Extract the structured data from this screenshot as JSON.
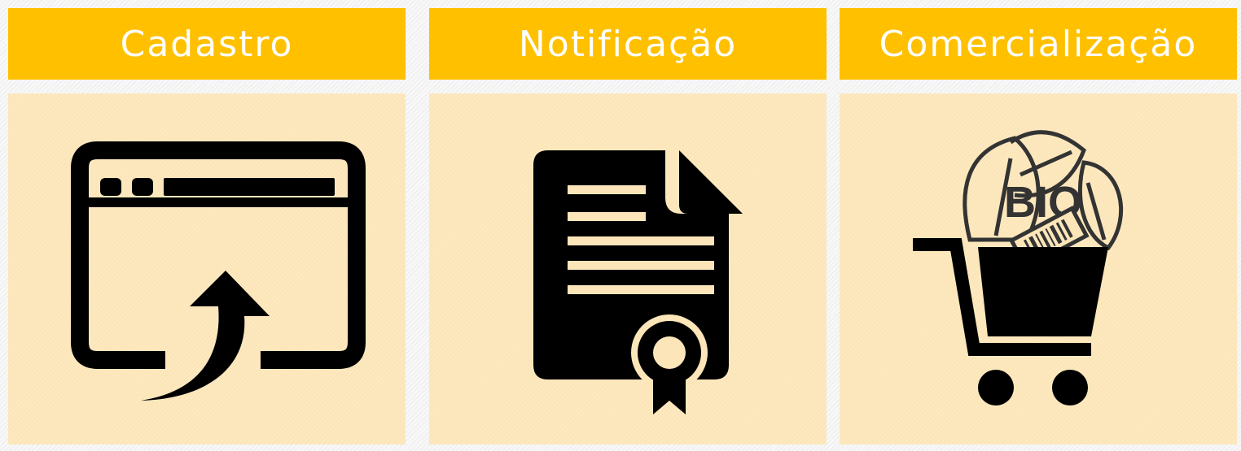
{
  "columns": [
    {
      "label": "Cadastro",
      "icon": "browser-upload-icon"
    },
    {
      "label": "Notificação",
      "icon": "certificate-document-icon"
    },
    {
      "label": "Comercialização",
      "icon": "bio-shopping-cart-icon"
    }
  ],
  "bio_badge": "BIO",
  "colors": {
    "header_bg": "#ffc000",
    "header_text": "#ffffff",
    "panel_bg": "#fce6b9",
    "icon": "#000000"
  }
}
